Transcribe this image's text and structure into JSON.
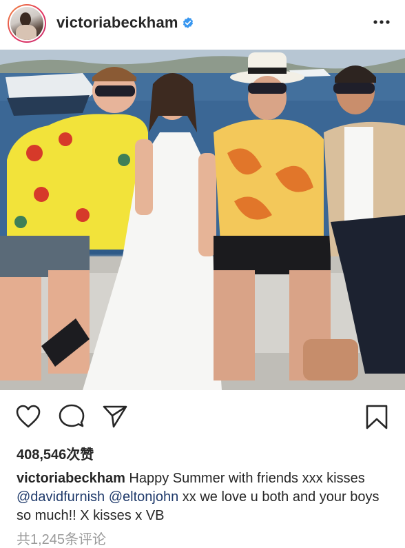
{
  "header": {
    "username": "victoriabeckham",
    "verified": true,
    "more_icon": "more-horizontal-icon",
    "avatar_icon": "profile-avatar"
  },
  "photo": {
    "subject": "post-photo"
  },
  "actions": {
    "like_icon": "heart-icon",
    "comment_icon": "comment-icon",
    "share_icon": "send-icon",
    "save_icon": "bookmark-icon"
  },
  "likes": {
    "text": "408,546次赞"
  },
  "caption": {
    "username": "victoriabeckham",
    "text_1": " Happy Summer with friends xxx kisses ",
    "mention_1": "@davidfurnish",
    "text_2": " ",
    "mention_2": "@eltonjohn",
    "text_3": " xx we love u both and your boys so much!! X kisses x VB"
  },
  "comments": {
    "text": "共1,245条评论"
  },
  "colors": {
    "text": "#262626",
    "muted": "#9a9a9a",
    "verified": "#3897f0",
    "story_ring_start": "#ef8a3c",
    "story_ring_end": "#c9326f"
  }
}
